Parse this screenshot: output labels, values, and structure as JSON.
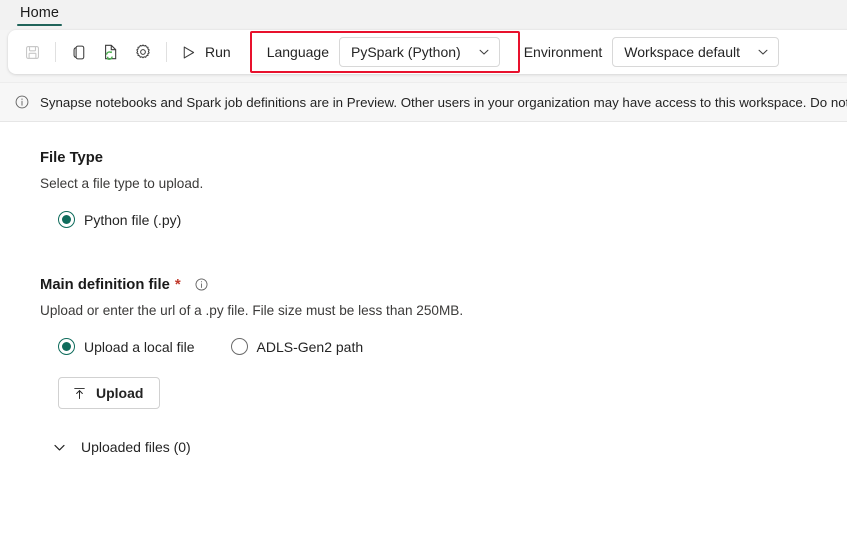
{
  "window": {
    "tabs": [
      {
        "label": "Home",
        "active": true
      }
    ]
  },
  "toolbar": {
    "save_icon": "save-icon",
    "copy_icon": "copy-icon",
    "refresh_icon": "refresh-document-icon",
    "settings_icon": "gear-icon",
    "run_icon": "play-icon",
    "run_label": "Run",
    "language_label": "Language",
    "language_value": "PySpark (Python)",
    "environment_label": "Environment",
    "environment_value": "Workspace default",
    "chevron_icon": "chevron-down-icon",
    "highlight_color": "#e8112d"
  },
  "banner": {
    "info_icon": "info-icon",
    "text": "Synapse notebooks and Spark job definitions are in Preview. Other users in your organization may have access to this workspace. Do not use these items"
  },
  "main": {
    "file_type": {
      "title": "File Type",
      "description": "Select a file type to upload.",
      "options": [
        {
          "label": "Python file (.py)",
          "selected": true
        }
      ]
    },
    "main_definition_file": {
      "title": "Main definition file",
      "required_marker": "*",
      "info_icon": "info-icon",
      "description": "Upload or enter the url of a .py file. File size must be less than 250MB.",
      "options": [
        {
          "label": "Upload a local file",
          "selected": true
        },
        {
          "label": "ADLS-Gen2 path",
          "selected": false
        }
      ],
      "upload_button": {
        "label": "Upload",
        "icon": "upload-icon"
      },
      "uploaded_files": {
        "label": "Uploaded files (0)",
        "icon": "chevron-down-icon",
        "expanded": false
      }
    }
  },
  "theme": {
    "accent": "#0f6c5c",
    "tab_underline": "#20645a",
    "required": "#c0392b"
  }
}
